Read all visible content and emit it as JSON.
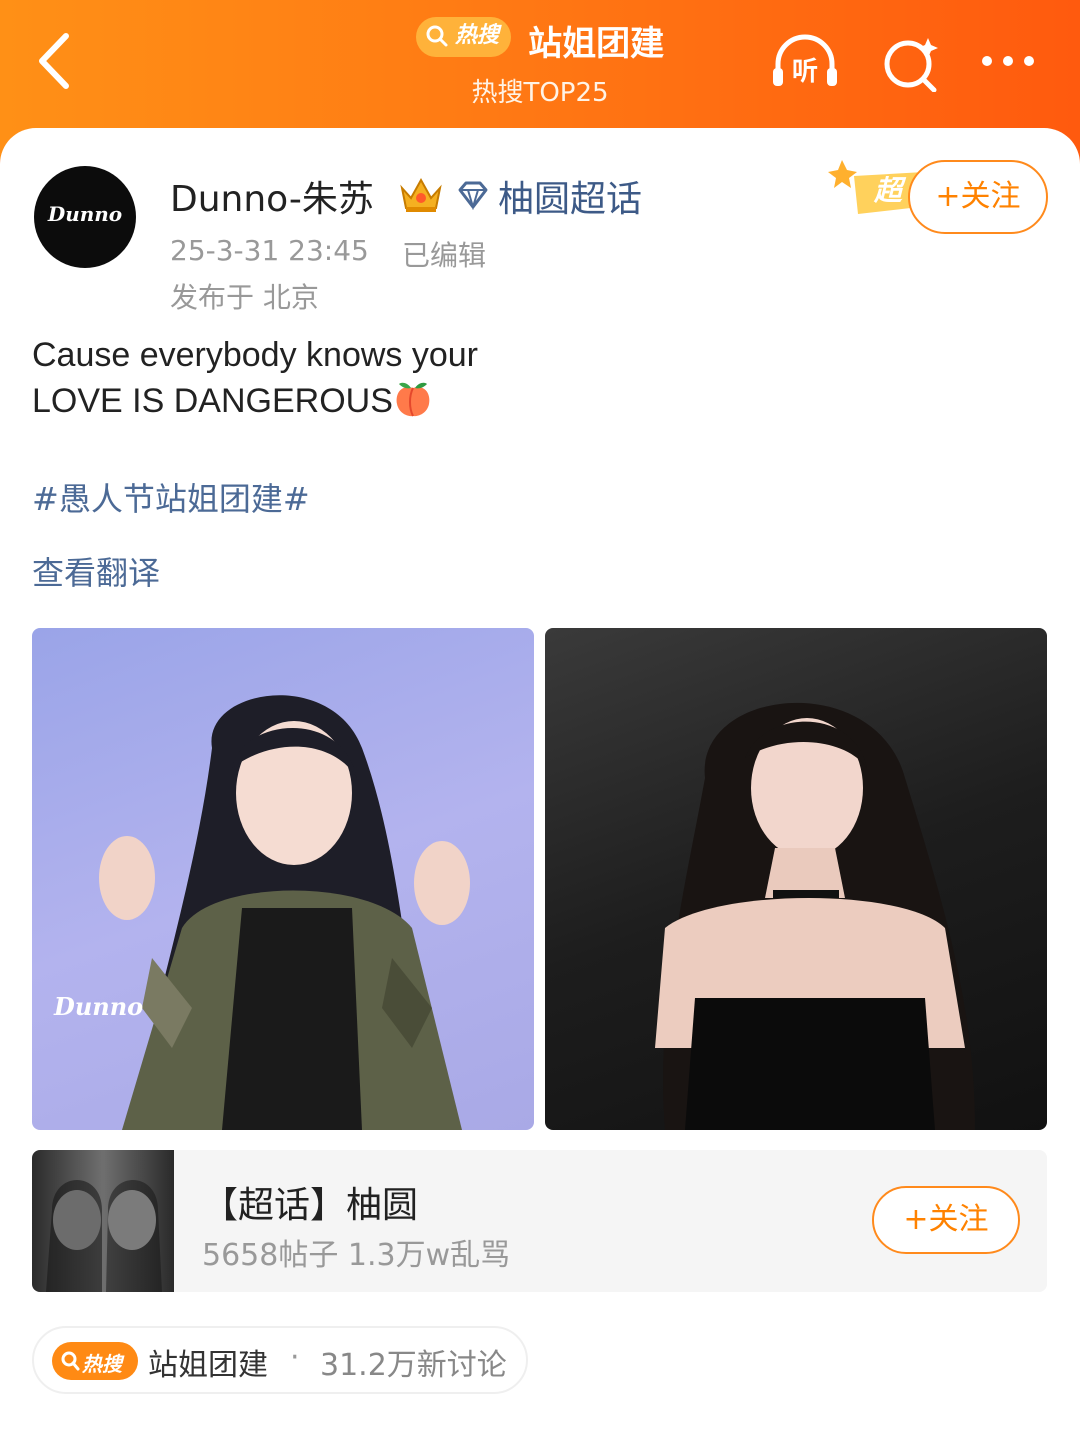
{
  "header": {
    "hot_badge": "热搜",
    "title": "站姐团建",
    "subtitle": "热搜TOP25",
    "listen_label": "听"
  },
  "post": {
    "author": "Dunno-朱苏",
    "avatar_text": "Dunno",
    "chaohua": "柚圆超话",
    "time": "25-3-31 23:45",
    "edited": "已编辑",
    "location": "发布于 北京",
    "super_badge": "超",
    "follow_label": "+关注",
    "text_line1": "Cause everybody knows your",
    "text_line2": "LOVE IS DANGEROUS",
    "hashtag": "#愚人节站姐团建#",
    "translate": "查看翻译",
    "photo_watermark": "Dunno"
  },
  "topic": {
    "name": "【超话】柚圆",
    "stats": "5658帖子 1.3万w乱骂",
    "follow_label": "+关注"
  },
  "hot_tag": {
    "badge": "热搜",
    "name": "站姐团建",
    "dot": "·",
    "stat": "31.2万新讨论"
  },
  "colors": {
    "accent": "#ff8200",
    "link": "#4c6a96",
    "header_start": "#ff9016",
    "header_end": "#ff5a0e"
  },
  "icons": [
    "back-icon",
    "search-icon",
    "listen-icon",
    "ai-search-icon",
    "more-icon",
    "crown-icon",
    "diamond-icon",
    "peach-icon"
  ]
}
